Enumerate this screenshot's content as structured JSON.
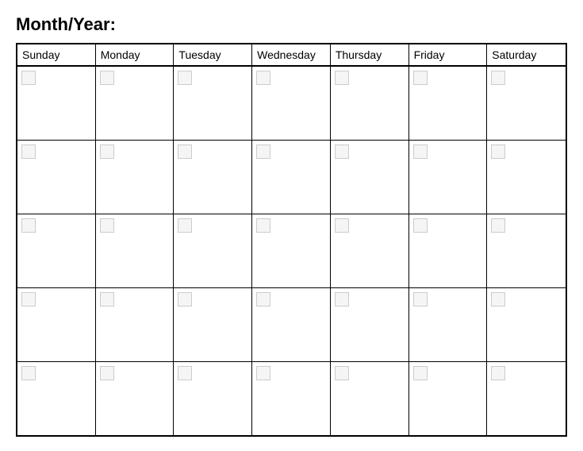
{
  "title": "Month/Year:",
  "days": [
    "Sunday",
    "Monday",
    "Tuesday",
    "Wednesday",
    "Thursday",
    "Friday",
    "Saturday"
  ],
  "rows": 5
}
